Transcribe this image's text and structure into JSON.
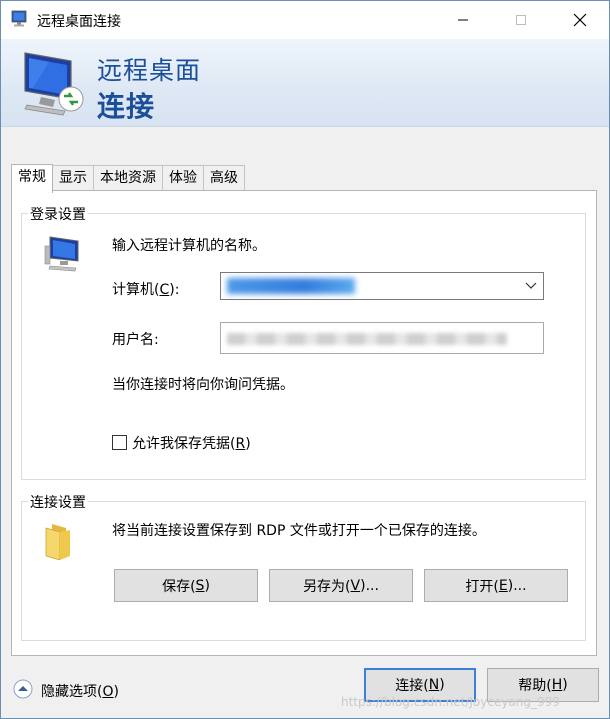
{
  "window": {
    "title": "远程桌面连接",
    "controls": {
      "minimize": "minimize-icon",
      "maximize": "maximize-icon",
      "close": "close-icon"
    }
  },
  "banner": {
    "line1": "远程桌面",
    "line2": "连接"
  },
  "tabs": [
    {
      "label": "常规",
      "active": true
    },
    {
      "label": "显示",
      "active": false
    },
    {
      "label": "本地资源",
      "active": false
    },
    {
      "label": "体验",
      "active": false
    },
    {
      "label": "高级",
      "active": false
    }
  ],
  "login": {
    "group_title": "登录设置",
    "instruction": "输入远程计算机的名称。",
    "computer_label_pre": "计算机(",
    "computer_label_key": "C",
    "computer_label_post": "):",
    "username_label": "用户名:",
    "note": "当你连接时将向你询问凭据。",
    "save_cred_pre": "允许我保存凭据(",
    "save_cred_key": "R",
    "save_cred_post": ")",
    "save_cred_checked": false
  },
  "connection": {
    "group_title": "连接设置",
    "instruction": "将当前连接设置保存到 RDP 文件或打开一个已保存的连接。",
    "save_pre": "保存(",
    "save_key": "S",
    "save_post": ")",
    "saveas_pre": "另存为(",
    "saveas_key": "V",
    "saveas_post": ")...",
    "open_pre": "打开(",
    "open_key": "E",
    "open_post": ")..."
  },
  "footer": {
    "hide_pre": "隐藏选项(",
    "hide_key": "O",
    "hide_post": ")",
    "connect_pre": "连接(",
    "connect_key": "N",
    "connect_post": ")",
    "help_pre": "帮助(",
    "help_key": "H",
    "help_post": ")"
  },
  "watermark": "https://blog.csdn.net/Joyceyang_999",
  "colors": {
    "accent": "#1c4f99",
    "primary_border": "#3b7fd6",
    "button_face": "#e1e1e1"
  }
}
